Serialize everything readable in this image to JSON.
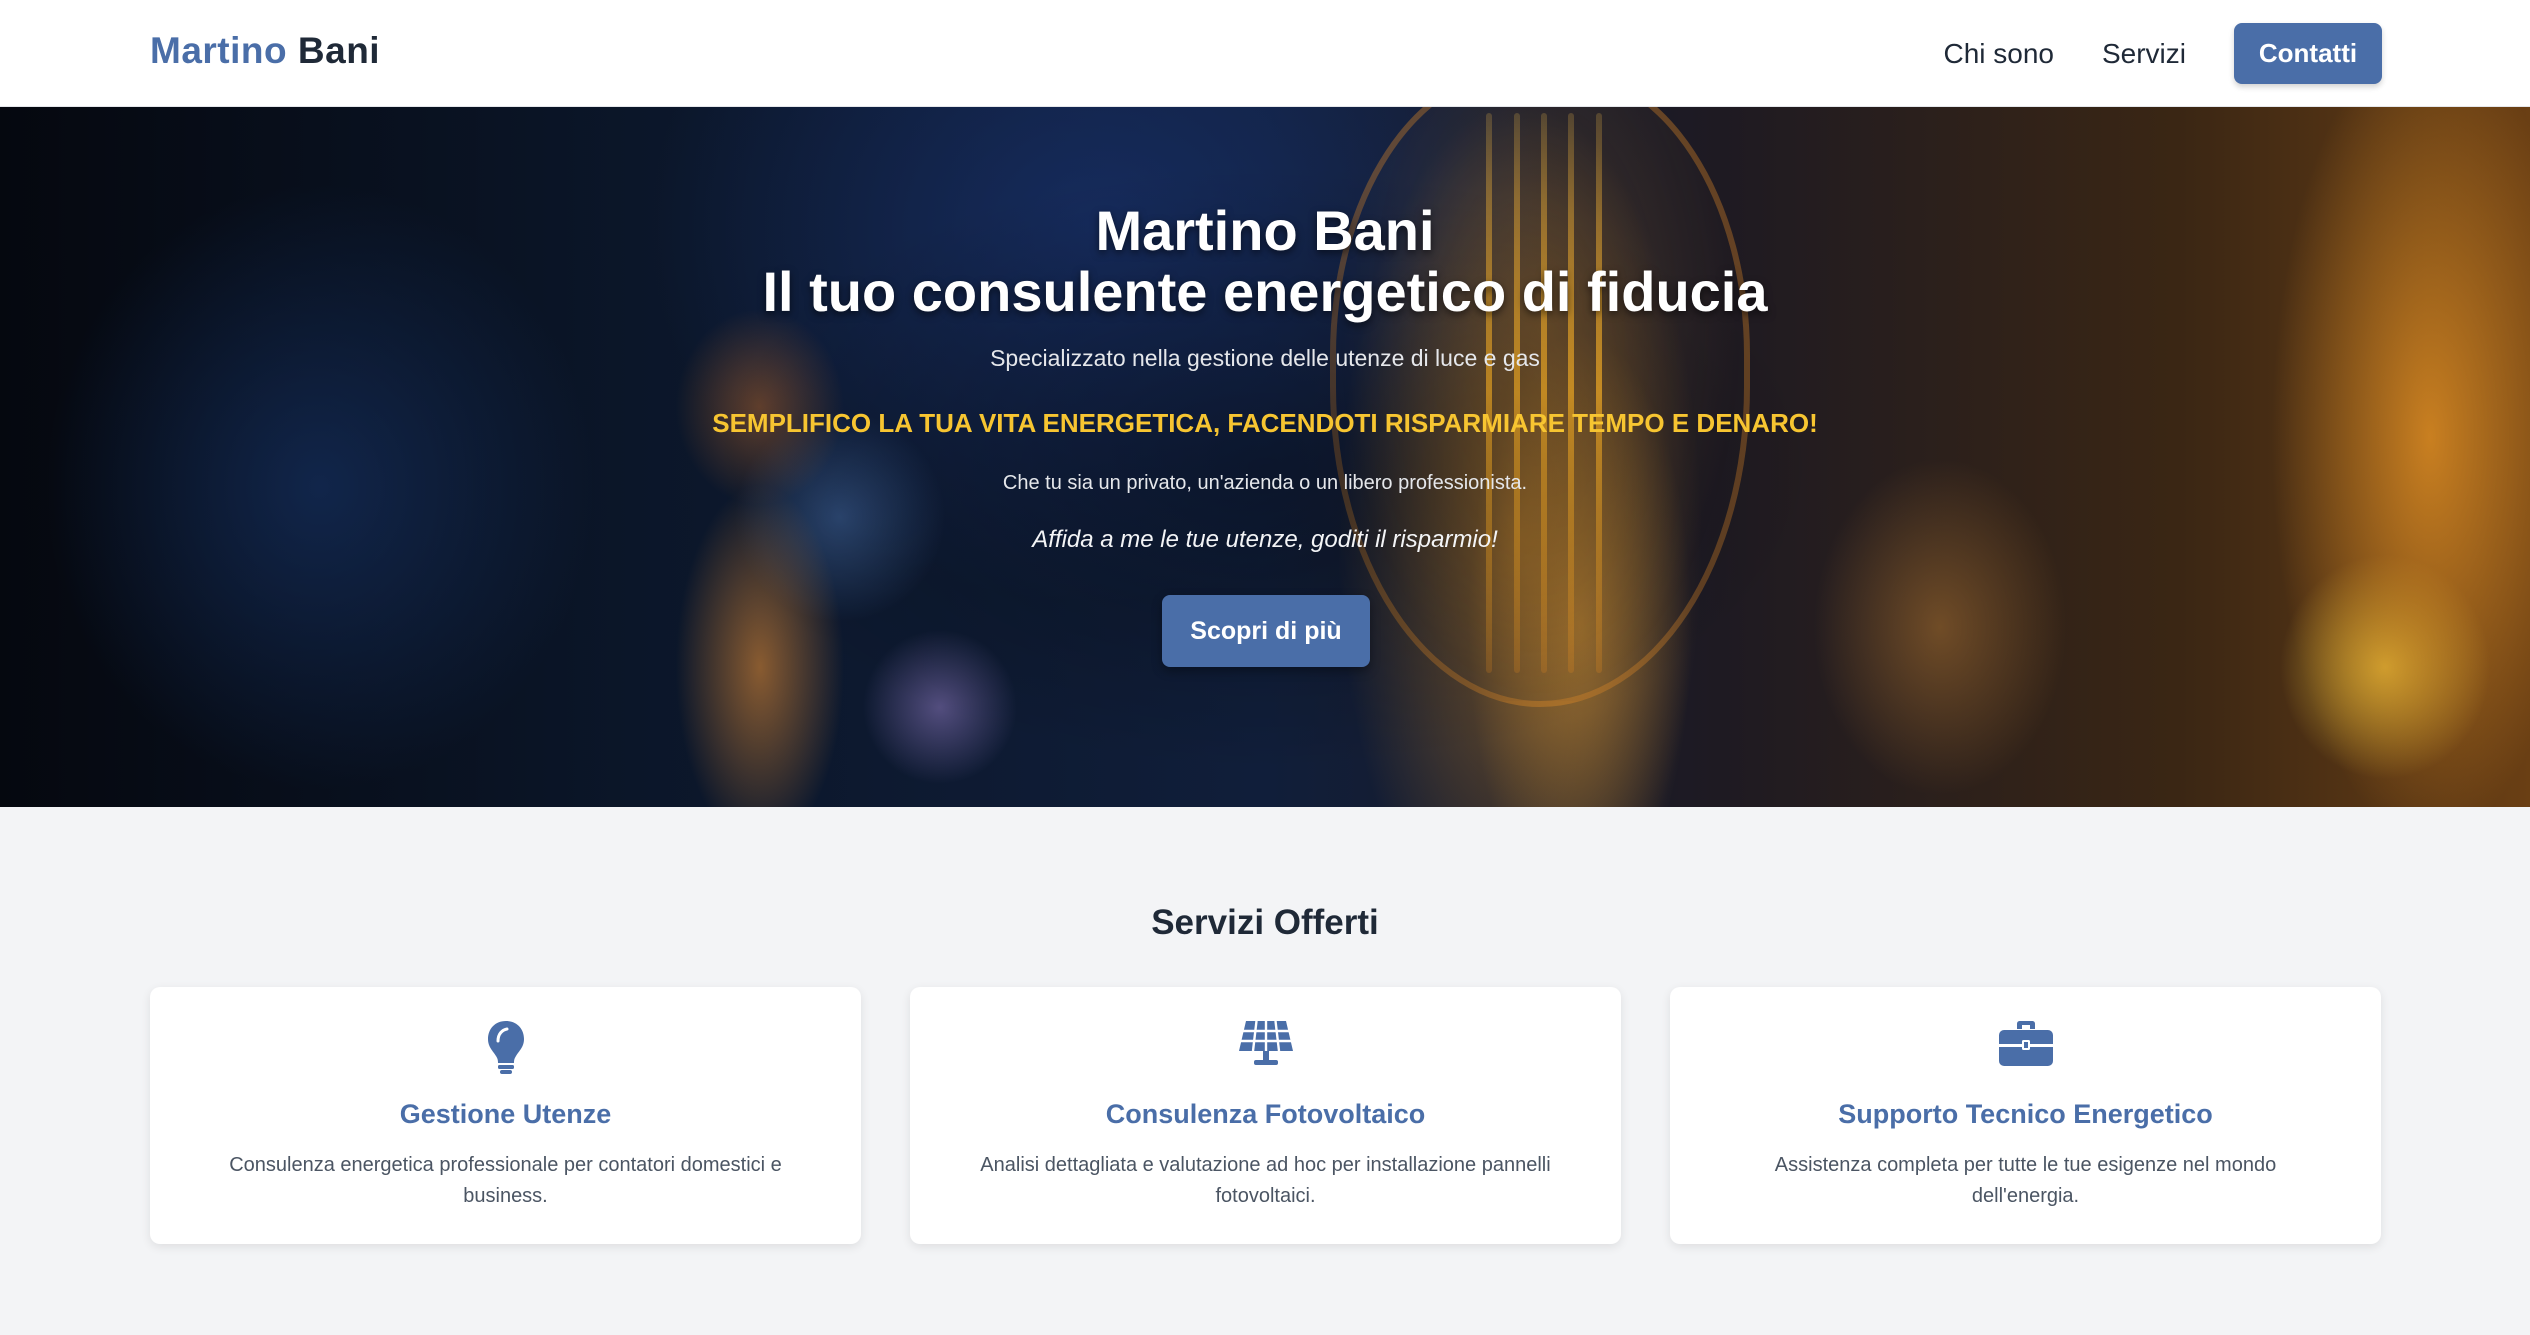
{
  "navbar": {
    "brand_first": "Martino",
    "brand_last": "Bani",
    "links": [
      "Chi sono",
      "Servizi"
    ],
    "cta_label": "Contatti"
  },
  "hero": {
    "title_line1": "Martino Bani",
    "title_line2": "Il tuo consulente energetico di fiducia",
    "subtitle": "Specializzato nella gestione delle utenze di luce e gas",
    "slogan": "SEMPLIFICO LA TUA VITA ENERGETICA, FACENDOTI RISPARMIARE TEMPO E DENARO!",
    "text": "Che tu sia un privato, un'azienda o un libero professionista.",
    "italic": "Affida a me le tue utenze, goditi il risparmio!",
    "button_label": "Scopri di più"
  },
  "services": {
    "title": "Servizi Offerti",
    "cards": [
      {
        "icon": "lightbulb-icon",
        "title": "Gestione Utenze",
        "description": "Consulenza energetica professionale per contatori domestici e business."
      },
      {
        "icon": "solar-panel-icon",
        "title": "Consulenza Fotovoltaico",
        "description": "Analisi dettagliata e valutazione ad hoc per installazione pannelli fotovoltaici."
      },
      {
        "icon": "toolbox-icon",
        "title": "Supporto Tecnico Energetico",
        "description": "Assistenza completa per tutte le tue esigenze nel mondo dell'energia."
      }
    ]
  },
  "colors": {
    "accent": "#4a6ea8",
    "slogan": "#f7c531",
    "dark_text": "#1f2937",
    "section_bg": "#f3f4f6"
  }
}
